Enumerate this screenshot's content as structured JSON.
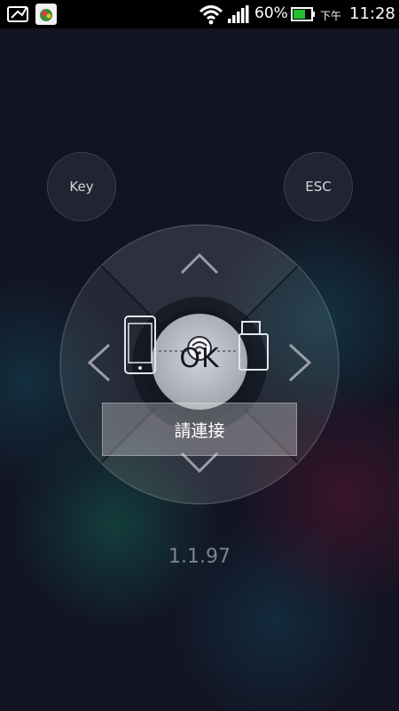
{
  "status_bar": {
    "battery_percent": "60%",
    "period": "下午",
    "time": "11:28",
    "icons": [
      "notification-app-icon",
      "notification-app-icon-2",
      "wifi-icon",
      "signal-icon",
      "battery-icon"
    ]
  },
  "remote": {
    "key_label": "Key",
    "esc_label": "ESC",
    "ok_label": "OK",
    "connect_label": "請連接",
    "icons": [
      "chevron-up-icon",
      "chevron-down-icon",
      "chevron-left-icon",
      "chevron-right-icon",
      "phone-icon",
      "dongle-icon",
      "wifi-connect-icon"
    ]
  },
  "version": "1.1.97",
  "colors": {
    "background": "#121423",
    "status_bar": "#000000",
    "battery_fill": "#22c02a",
    "version_text": "#7e828f"
  }
}
